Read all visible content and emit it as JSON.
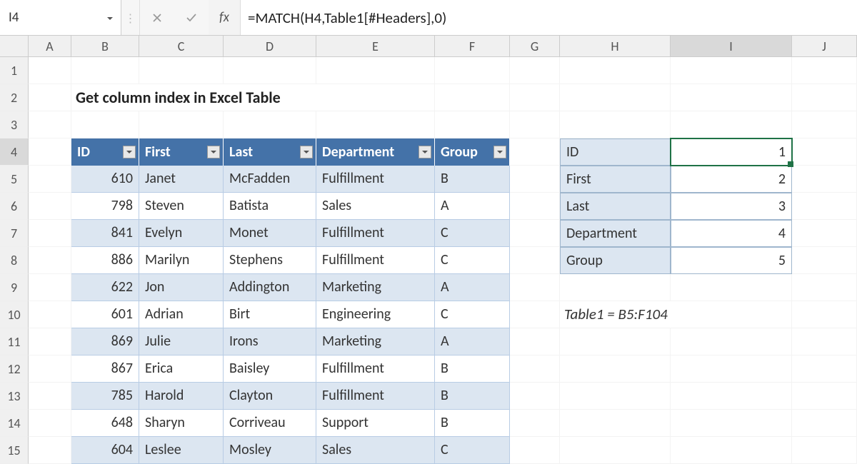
{
  "name_box": "I4",
  "formula": "=MATCH(H4,Table1[#Headers],0)",
  "fx_label": "fx",
  "columns": [
    "A",
    "B",
    "C",
    "D",
    "E",
    "F",
    "G",
    "H",
    "I",
    "J"
  ],
  "rows": [
    "1",
    "2",
    "3",
    "4",
    "5",
    "6",
    "7",
    "8",
    "9",
    "10",
    "11",
    "12",
    "13",
    "14",
    "15"
  ],
  "title": "Get column index in Excel Table",
  "table_headers": [
    "ID",
    "First",
    "Last",
    "Department",
    "Group"
  ],
  "table_rows": [
    {
      "id": "610",
      "first": "Janet",
      "last": "McFadden",
      "dept": "Fulfillment",
      "grp": "B"
    },
    {
      "id": "798",
      "first": "Steven",
      "last": "Batista",
      "dept": "Sales",
      "grp": "A"
    },
    {
      "id": "841",
      "first": "Evelyn",
      "last": "Monet",
      "dept": "Fulfillment",
      "grp": "C"
    },
    {
      "id": "886",
      "first": "Marilyn",
      "last": "Stephens",
      "dept": "Fulfillment",
      "grp": "C"
    },
    {
      "id": "622",
      "first": "Jon",
      "last": "Addington",
      "dept": "Marketing",
      "grp": "A"
    },
    {
      "id": "601",
      "first": "Adrian",
      "last": "Birt",
      "dept": "Engineering",
      "grp": "C"
    },
    {
      "id": "869",
      "first": "Julie",
      "last": "Irons",
      "dept": "Marketing",
      "grp": "A"
    },
    {
      "id": "867",
      "first": "Erica",
      "last": "Baisley",
      "dept": "Fulfillment",
      "grp": "B"
    },
    {
      "id": "785",
      "first": "Harold",
      "last": "Clayton",
      "dept": "Fulfillment",
      "grp": "B"
    },
    {
      "id": "648",
      "first": "Sharyn",
      "last": "Corriveau",
      "dept": "Support",
      "grp": "B"
    },
    {
      "id": "604",
      "first": "Leslee",
      "last": "Mosley",
      "dept": "Sales",
      "grp": "C"
    }
  ],
  "lookup": [
    {
      "key": "ID",
      "val": "1"
    },
    {
      "key": "First",
      "val": "2"
    },
    {
      "key": "Last",
      "val": "3"
    },
    {
      "key": "Department",
      "val": "4"
    },
    {
      "key": "Group",
      "val": "5"
    }
  ],
  "note": "Table1 = B5:F104",
  "selected_cell": "I4"
}
